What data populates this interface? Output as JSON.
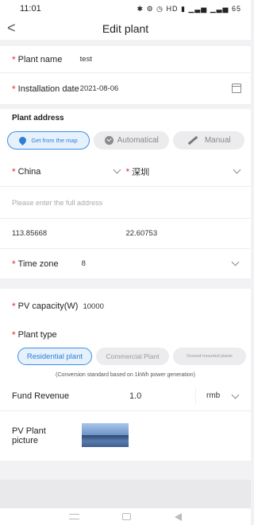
{
  "status_bar": {
    "time": "11:01",
    "icons": "✱ ⚙ ◷ HD ▮ ▁▃▅ ▁▃▅ 65"
  },
  "header": {
    "back_glyph": "<",
    "title": "Edit plant"
  },
  "plant_name": {
    "label": "Plant name",
    "value": "test"
  },
  "install_date": {
    "label": "Installation date",
    "value": "2021-08-06"
  },
  "plant_address": {
    "heading": "Plant address",
    "modes": [
      "Get from the map",
      "Automatical",
      "Manual"
    ],
    "country": "China",
    "city": "深圳",
    "address_placeholder": "Please enter the full address",
    "longitude": "113.85668",
    "latitude": "22.60753"
  },
  "time_zone": {
    "label": "Time zone",
    "value": "8"
  },
  "pv_capacity": {
    "label": "PV capacity(W)",
    "value": "10000"
  },
  "plant_type": {
    "label": "Plant type",
    "options": [
      "Residential plant",
      "Commercial Plant",
      "Ground-mounted plants"
    ],
    "selected": "Residential plant"
  },
  "conversion_note": "(Conversion standard based on 1kWh power generation)",
  "fund_revenue": {
    "label": "Fund Revenue",
    "value": "1.0",
    "unit": "rmb"
  },
  "pv_picture": {
    "label": "PV Plant picture"
  },
  "required_mark": "*",
  "colors": {
    "accent": "#2b7fd8",
    "required": "#e0303a"
  }
}
